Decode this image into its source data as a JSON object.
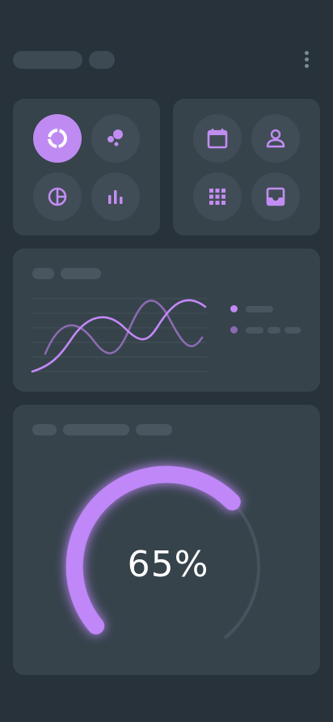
{
  "header": {
    "menu_icon": "more-vertical-icon"
  },
  "quick_actions_left": {
    "icons": [
      "donut-chart-icon",
      "bubble-chart-icon",
      "pie-chart-icon",
      "bar-chart-icon"
    ],
    "active_index": 0
  },
  "quick_actions_right": {
    "icons": [
      "calendar-icon",
      "profile-icon",
      "grid-apps-icon",
      "inbox-icon"
    ]
  },
  "line_chart": {
    "series_count": 2,
    "colors": [
      "#c388f7",
      "#8b6bb0"
    ]
  },
  "gauge": {
    "value_label": "65%",
    "progress_fraction": 0.65,
    "accent": "#bf87f8",
    "track": "#46535c"
  },
  "colors": {
    "background": "#27323a",
    "card": "#36434b",
    "accent": "#bf8bf2"
  }
}
